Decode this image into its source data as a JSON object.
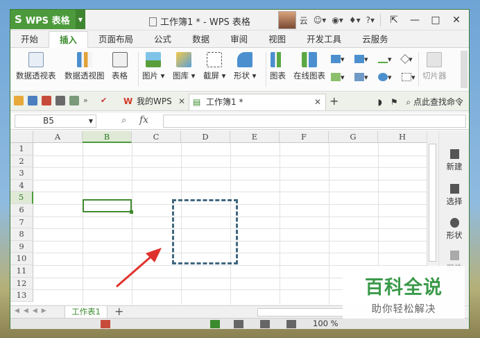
{
  "app": {
    "name": "WPS 表格",
    "window_title": "工作簿1 * - WPS 表格",
    "user_name": "云"
  },
  "ribbon_tabs": [
    "开始",
    "插入",
    "页面布局",
    "公式",
    "数据",
    "审阅",
    "视图",
    "开发工具",
    "云服务"
  ],
  "active_ribbon_tab": "插入",
  "ribbon_buttons": {
    "pivot_table": "数据透视表",
    "pivot_chart": "数据透视图",
    "table": "表格",
    "picture": "图片",
    "gallery": "图库",
    "screenshot": "截屏",
    "shapes": "形状",
    "chart": "图表",
    "online_chart": "在线图表",
    "slicer": "切片器"
  },
  "doc_tabs": [
    {
      "label": "我的WPS",
      "active": false
    },
    {
      "label": "工作簿1 *",
      "active": true
    }
  ],
  "find_command": "点此查找命令",
  "formula_bar": {
    "name_box": "B5",
    "fx_label": "fx",
    "value": ""
  },
  "columns": [
    "A",
    "B",
    "C",
    "D",
    "E",
    "F",
    "G",
    "H"
  ],
  "selected_column": "B",
  "rows": [
    "1",
    "2",
    "3",
    "4",
    "5",
    "6",
    "7",
    "8",
    "9",
    "10",
    "11",
    "12",
    "13"
  ],
  "selected_row": "5",
  "side_panel": [
    {
      "label": "新建",
      "icon": "new-doc-icon",
      "enabled": true
    },
    {
      "label": "选择",
      "icon": "select-cursor-icon",
      "enabled": true
    },
    {
      "label": "形状",
      "icon": "shapes-icon",
      "enabled": true
    },
    {
      "label": "属性",
      "icon": "properties-icon",
      "enabled": false
    }
  ],
  "sheet_tabs": [
    "工作表1"
  ],
  "active_sheet": "工作表1",
  "status_bar": {
    "zoom": "100 %"
  },
  "watermark": {
    "title": "百科全说",
    "subtitle": "助你轻松解决"
  },
  "colors": {
    "accent_green": "#4c9a3c",
    "annotation_red": "#e0322c",
    "dash_box": "#40667f"
  }
}
